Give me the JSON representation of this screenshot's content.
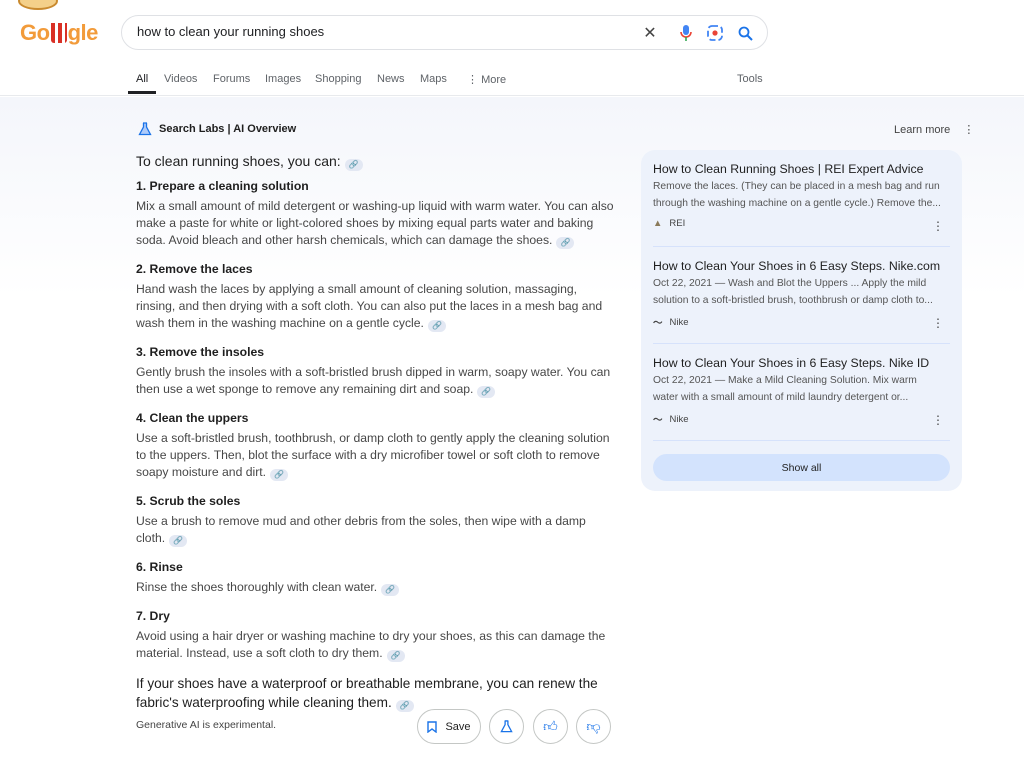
{
  "header": {
    "logo": "Google",
    "query": "how to clean your running shoes"
  },
  "tabs": [
    {
      "label": "All"
    },
    {
      "label": "Videos"
    },
    {
      "label": "Forums"
    },
    {
      "label": "Images"
    },
    {
      "label": "Shopping"
    },
    {
      "label": "News"
    },
    {
      "label": "Maps"
    },
    {
      "label": "More"
    },
    {
      "label": "Tools"
    }
  ],
  "overview": {
    "title": "Search Labs | AI Overview",
    "learn_more": "Learn more",
    "intro": "To clean running shoes, you can:",
    "steps": [
      {
        "title": "1. Prepare a cleaning solution",
        "text": "Mix a small amount of mild detergent or washing-up liquid with warm water. You can also make a paste for white or light-colored shoes by mixing equal parts water and baking soda. Avoid bleach and other harsh chemicals, which can damage the shoes."
      },
      {
        "title": "2. Remove the laces",
        "text": "Hand wash the laces by applying a small amount of cleaning solution, massaging, rinsing, and then drying with a soft cloth. You can also put the laces in a mesh bag and wash them in the washing machine on a gentle cycle."
      },
      {
        "title": "3. Remove the insoles",
        "text": "Gently brush the insoles with a soft-bristled brush dipped in warm, soapy water. You can then use a wet sponge to remove any remaining dirt and soap."
      },
      {
        "title": "4. Clean the uppers",
        "text": "Use a soft-bristled brush, toothbrush, or damp cloth to gently apply the cleaning solution to the uppers. Then, blot the surface with a dry microfiber towel or soft cloth to remove soapy moisture and dirt."
      },
      {
        "title": "5. Scrub the soles",
        "text": "Use a brush to remove mud and other debris from the soles, then wipe with a damp cloth."
      },
      {
        "title": "6. Rinse",
        "text": "Rinse the shoes thoroughly with clean water."
      },
      {
        "title": "7. Dry",
        "text": "Avoid using a hair dryer or washing machine to dry your shoes, as this can damage the material. Instead, use a soft cloth to dry them."
      }
    ],
    "outro": "If your shoes have a waterproof or breathable membrane, you can renew the fabric's waterproofing while cleaning them.",
    "disclaimer": "Generative AI is experimental.",
    "save": "Save"
  },
  "sources": [
    {
      "title": "How to Clean Running Shoes | REI Expert Advice",
      "snippet1": "Remove the laces. (They can be placed in a mesh bag and run",
      "snippet2": "through the washing machine on a gentle cycle.) Remove the...",
      "site": "REI"
    },
    {
      "title": "How to Clean Your Shoes in 6 Easy Steps. Nike.com",
      "snippet1": "Oct 22, 2021 — Wash and Blot the Uppers ... Apply the mild",
      "snippet2": "solution to a soft-bristled brush, toothbrush or damp cloth to...",
      "site": "Nike"
    },
    {
      "title": "How to Clean Your Shoes in 6 Easy Steps. Nike ID",
      "snippet1": "Oct 22, 2021 — Make a Mild Cleaning Solution. Mix warm",
      "snippet2": "water with a small amount of mild laundry detergent or...",
      "site": "Nike"
    }
  ],
  "show_all": "Show all",
  "colors": {
    "accent": "#1a73e8",
    "panel": "#edf2fb",
    "chip": "#d3e3fd"
  }
}
